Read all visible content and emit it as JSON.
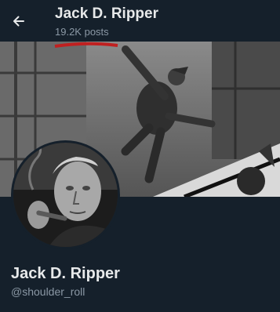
{
  "header": {
    "title": "Jack D. Ripper",
    "post_count": "19.2K posts",
    "back_icon": "arrow-left-icon"
  },
  "profile": {
    "display_name": "Jack D. Ripper",
    "handle": "@shoulder_roll"
  },
  "colors": {
    "background": "#15202b",
    "primary_text": "#e7e9ea",
    "secondary_text": "#8b98a5"
  }
}
